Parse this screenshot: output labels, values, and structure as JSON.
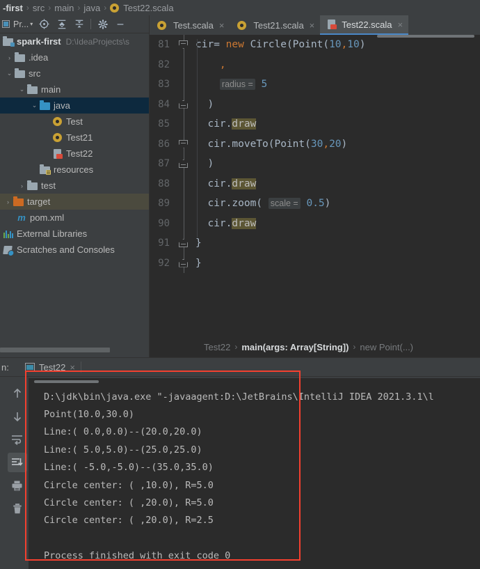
{
  "top_breadcrumb": {
    "segments": [
      {
        "text": "-first",
        "bold": true
      },
      {
        "text": "src",
        "bold": false
      },
      {
        "text": "main",
        "bold": false
      },
      {
        "text": "java",
        "bold": false
      },
      {
        "text": "Test22.scala",
        "bold": false,
        "icon": "scala-object-icon"
      }
    ],
    "separator": "›"
  },
  "project_panel": {
    "title": "Pr...",
    "caret": "▾",
    "toolbar_icons": [
      "locate-target-icon",
      "expand-all-icon",
      "collapse-all-icon",
      "settings-gear-icon",
      "hide-panel-icon"
    ],
    "tree": [
      {
        "label": "spark-first",
        "path": "D:\\IdeaProjects\\s",
        "icon": "module-folder-icon",
        "arrow": "",
        "indent": 0,
        "bold": true,
        "state": "normal"
      },
      {
        "label": ".idea",
        "path": "",
        "icon": "folder-icon",
        "arrow": "›",
        "indent": 1,
        "bold": false,
        "state": "normal"
      },
      {
        "label": "src",
        "path": "",
        "icon": "folder-icon",
        "arrow": "⌄",
        "indent": 1,
        "bold": false,
        "state": "normal"
      },
      {
        "label": "main",
        "path": "",
        "icon": "folder-icon",
        "arrow": "⌄",
        "indent": 2,
        "bold": false,
        "state": "normal"
      },
      {
        "label": "java",
        "path": "",
        "icon": "source-folder-icon",
        "arrow": "⌄",
        "indent": 3,
        "bold": false,
        "state": "selected"
      },
      {
        "label": "Test",
        "path": "",
        "icon": "scala-object-icon",
        "arrow": "",
        "indent": 4,
        "bold": false,
        "state": "normal"
      },
      {
        "label": "Test21",
        "path": "",
        "icon": "scala-object-icon",
        "arrow": "",
        "indent": 4,
        "bold": false,
        "state": "normal"
      },
      {
        "label": "Test22",
        "path": "",
        "icon": "scala-script-file-icon",
        "arrow": "",
        "indent": 4,
        "bold": false,
        "state": "normal"
      },
      {
        "label": "resources",
        "path": "",
        "icon": "resources-folder-icon",
        "arrow": "",
        "indent": 3,
        "bold": false,
        "state": "normal"
      },
      {
        "label": "test",
        "path": "",
        "icon": "folder-icon",
        "arrow": "›",
        "indent": 2,
        "bold": false,
        "state": "normal"
      },
      {
        "label": "target",
        "path": "",
        "icon": "excluded-folder-icon",
        "arrow": "›",
        "indent": 1,
        "bold": false,
        "state": "highlighted"
      },
      {
        "label": "pom.xml",
        "path": "",
        "icon": "maven-icon",
        "arrow": "",
        "indent": 1,
        "bold": false,
        "state": "normal"
      },
      {
        "label": "External Libraries",
        "path": "",
        "icon": "libraries-icon",
        "arrow": "",
        "indent": 0,
        "bold": false,
        "state": "normal"
      },
      {
        "label": "Scratches and Consoles",
        "path": "",
        "icon": "scratches-icon",
        "arrow": "",
        "indent": 0,
        "bold": false,
        "state": "normal"
      }
    ]
  },
  "editor": {
    "tabs": [
      {
        "label": "Test.scala",
        "icon": "scala-object-icon",
        "active": false,
        "close": "×"
      },
      {
        "label": "Test21.scala",
        "icon": "scala-object-icon",
        "active": false,
        "close": "×"
      },
      {
        "label": "Test22.scala",
        "icon": "scala-script-file-icon",
        "active": true,
        "close": "×"
      }
    ],
    "lines": [
      {
        "num": "81",
        "fold": "dn",
        "tokens": [
          {
            "t": "cir= ",
            "c": "def"
          },
          {
            "t": "new ",
            "c": "kw"
          },
          {
            "t": "Circle(Point(",
            "c": "def"
          },
          {
            "t": "10",
            "c": "num"
          },
          {
            "t": ",",
            "c": "comma"
          },
          {
            "t": "10",
            "c": "num"
          },
          {
            "t": ")",
            "c": "def"
          }
        ]
      },
      {
        "num": "82",
        "fold": "line",
        "tokens": [
          {
            "t": "    ",
            "c": "def"
          },
          {
            "t": ",",
            "c": "comma"
          }
        ]
      },
      {
        "num": "83",
        "fold": "line",
        "tokens": [
          {
            "t": "    ",
            "c": "def"
          },
          {
            "t": "radius =",
            "c": "hint"
          },
          {
            "t": " ",
            "c": "def"
          },
          {
            "t": "5",
            "c": "num"
          }
        ]
      },
      {
        "num": "84",
        "fold": "up",
        "tokens": [
          {
            "t": "  )",
            "c": "def"
          }
        ]
      },
      {
        "num": "85",
        "fold": "line",
        "tokens": [
          {
            "t": "  cir.",
            "c": "def"
          },
          {
            "t": "draw",
            "c": "hl"
          }
        ]
      },
      {
        "num": "86",
        "fold": "dn",
        "tokens": [
          {
            "t": "  cir.moveTo(Point(",
            "c": "def"
          },
          {
            "t": "30",
            "c": "num"
          },
          {
            "t": ",",
            "c": "comma"
          },
          {
            "t": "20",
            "c": "num"
          },
          {
            "t": ")",
            "c": "def"
          }
        ]
      },
      {
        "num": "87",
        "fold": "up",
        "tokens": [
          {
            "t": "  )",
            "c": "def"
          }
        ]
      },
      {
        "num": "88",
        "fold": "line",
        "tokens": [
          {
            "t": "  cir.",
            "c": "def"
          },
          {
            "t": "draw",
            "c": "hl"
          }
        ]
      },
      {
        "num": "89",
        "fold": "line",
        "tokens": [
          {
            "t": "  cir.zoom( ",
            "c": "def"
          },
          {
            "t": "scale =",
            "c": "hint"
          },
          {
            "t": " ",
            "c": "def"
          },
          {
            "t": "0.5",
            "c": "num"
          },
          {
            "t": ")",
            "c": "def"
          }
        ]
      },
      {
        "num": "90",
        "fold": "line",
        "tokens": [
          {
            "t": "  cir.",
            "c": "def"
          },
          {
            "t": "draw",
            "c": "hl"
          }
        ]
      },
      {
        "num": "91",
        "fold": "up",
        "tokens": [
          {
            "t": "}",
            "c": "def"
          }
        ]
      },
      {
        "num": "92",
        "fold": "up0",
        "tokens": [
          {
            "t": "}",
            "c": "def"
          }
        ]
      }
    ],
    "breadcrumb": [
      {
        "text": "Test22",
        "current": false
      },
      {
        "text": "main(args: Array[String])",
        "current": true
      },
      {
        "text": "new Point(...)",
        "current": false
      }
    ],
    "breadcrumb_separator": "›"
  },
  "run_window": {
    "title": "n:",
    "tab_label": "Test22",
    "tab_close": "×",
    "toolbar_icons": [
      {
        "name": "rerun-up-icon",
        "glyph": "↑",
        "active": false
      },
      {
        "name": "down-arrow-icon",
        "glyph": "↓",
        "active": false
      },
      {
        "name": "soft-wrap-icon",
        "glyph": "soft-wrap",
        "active": false
      },
      {
        "name": "scroll-to-end-icon",
        "glyph": "scroll-end",
        "active": true
      },
      {
        "name": "print-icon",
        "glyph": "print",
        "active": false
      },
      {
        "name": "clear-all-trash-icon",
        "glyph": "trash",
        "active": false
      }
    ],
    "console_lines": [
      "D:\\jdk\\bin\\java.exe \"-javaagent:D:\\JetBrains\\IntelliJ IDEA 2021.3.1\\l",
      "Point(10.0,30.0)",
      "Line:( 0.0,0.0)--(20.0,20.0)",
      "Line:( 5.0,5.0)--(25.0,25.0)",
      "Line:( -5.0,-5.0)--(35.0,35.0)",
      "Circle center: ( ,10.0), R=5.0",
      "Circle center: ( ,20.0), R=5.0",
      "Circle center: ( ,20.0), R=2.5",
      "",
      "Process finished with exit code 0"
    ]
  },
  "annotation": {
    "highlight_color": "#f4402f",
    "name": "console-output-red-box"
  },
  "colors": {
    "panel_bg": "#3c3f41",
    "editor_bg": "#2b2b2b",
    "selection_blue": "#0d293e",
    "highlight_olive": "#4b4a3e",
    "accent_blue": "#4a88c7",
    "keyword_orange": "#cc7832",
    "number_blue": "#6897bb",
    "text": "#a9b7c6"
  }
}
